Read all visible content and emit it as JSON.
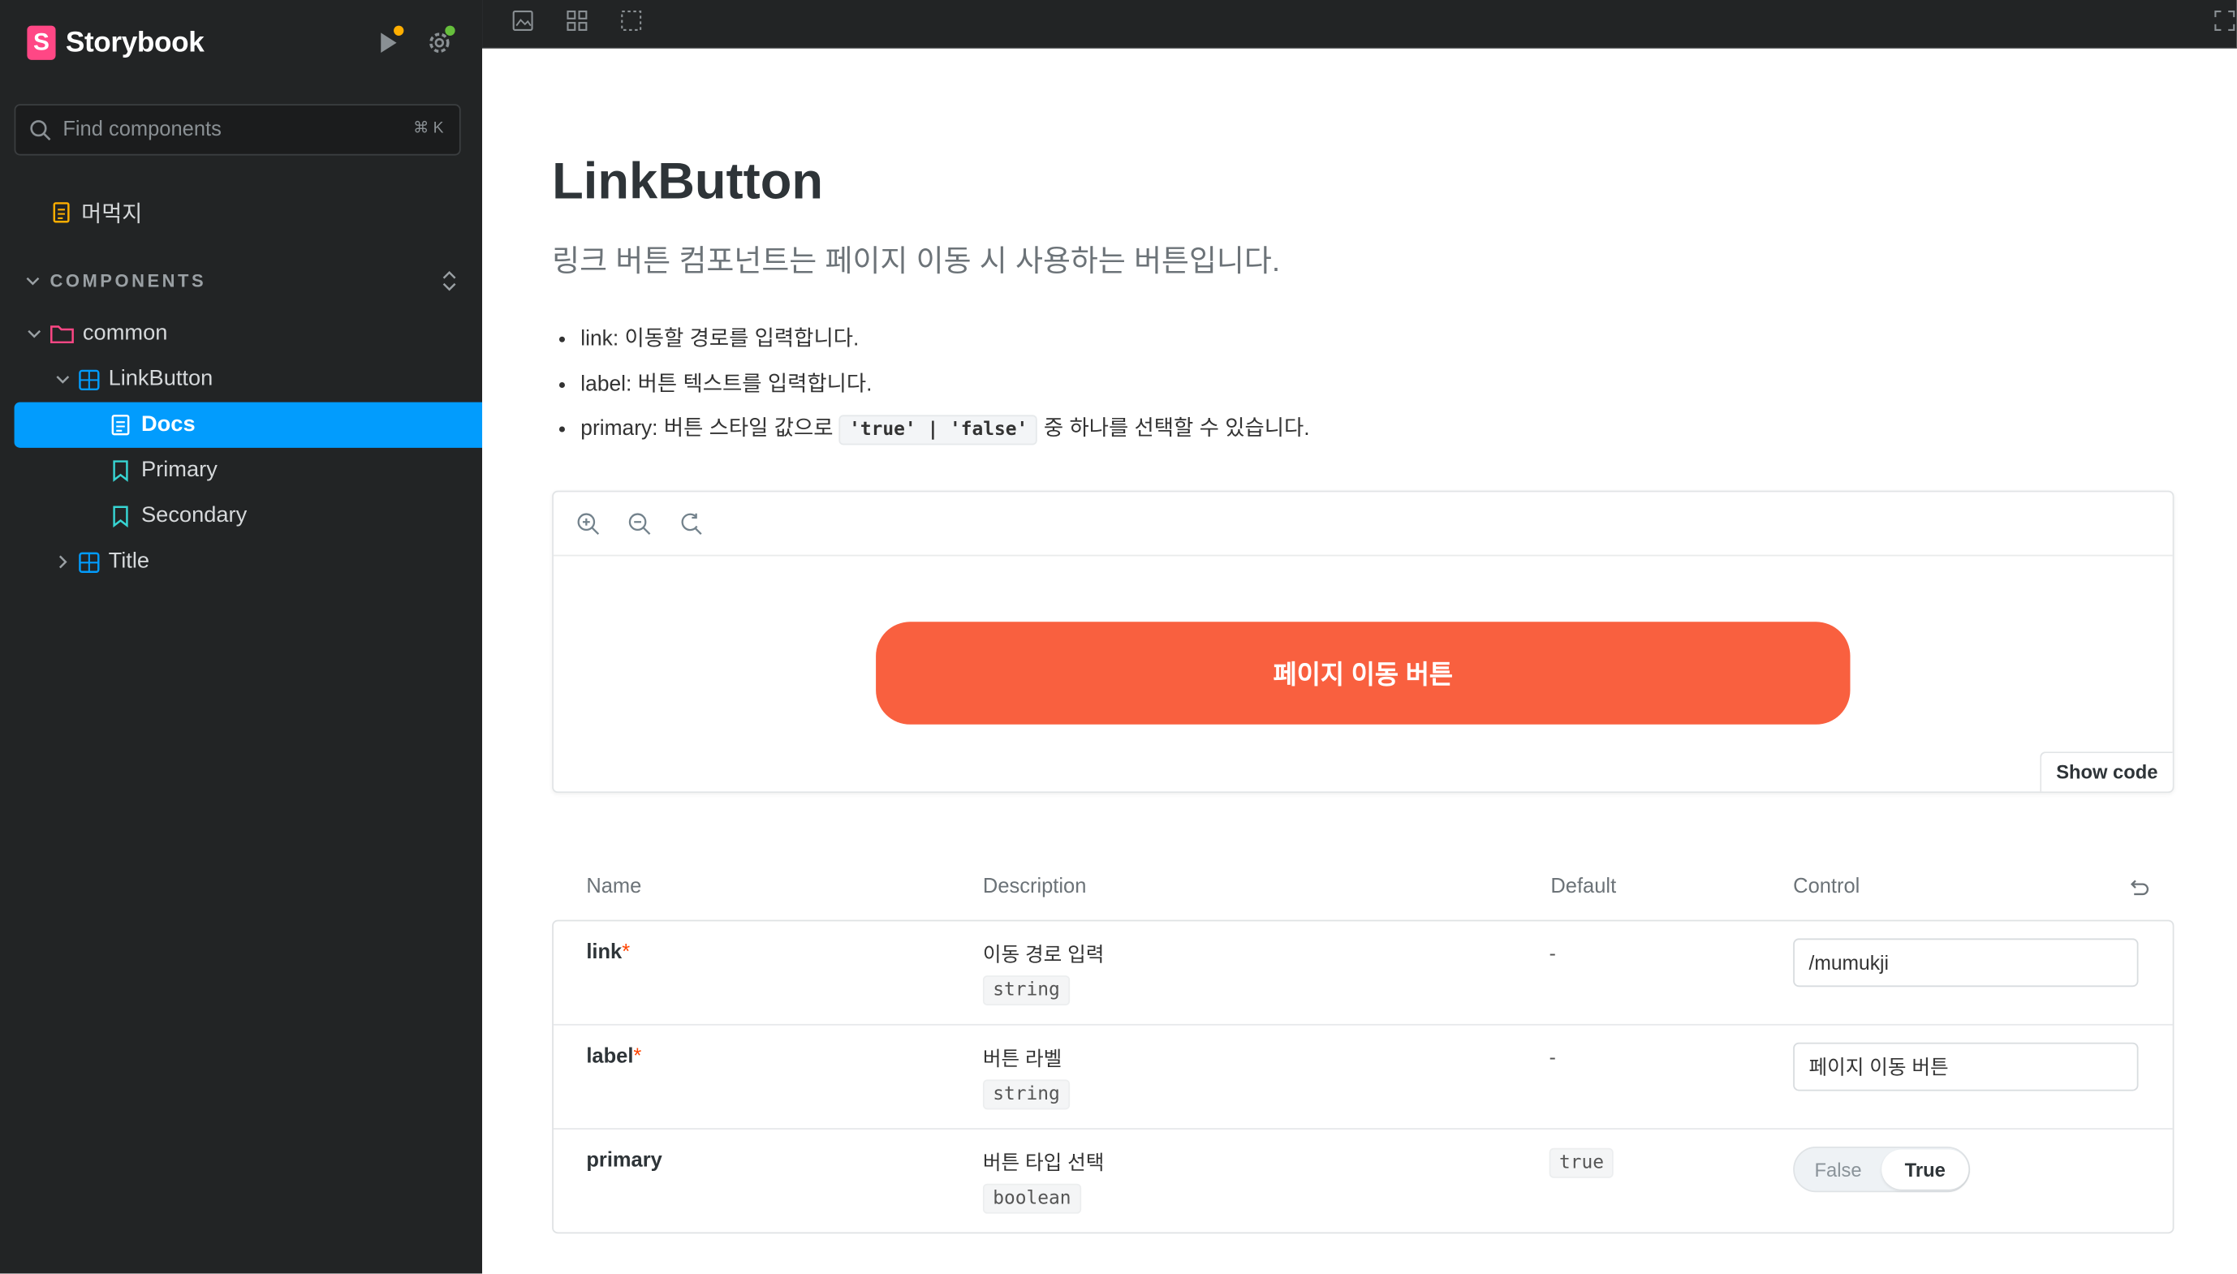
{
  "brand": {
    "name": "Storybook",
    "logo_letter": "S",
    "accent": "#ff4785",
    "link": "#029cfd"
  },
  "sidebar": {
    "search_placeholder": "Find components",
    "shortcut": "⌘ K",
    "intro_doc": "머먹지",
    "section_label": "COMPONENTS",
    "tree": {
      "group": "common",
      "component": "LinkButton",
      "stories": [
        "Docs",
        "Primary",
        "Secondary"
      ],
      "other_component": "Title"
    },
    "status_dots": {
      "warning": "#ffae00",
      "ok": "#66bf3c"
    }
  },
  "doc": {
    "title": "LinkButton",
    "subtitle": "링크 버튼 컴포넌트는 페이지 이동 시 사용하는 버튼입니다.",
    "bullets": {
      "b1": "link: 이동할 경로를 입력합니다.",
      "b2": "label: 버튼 텍스트를 입력합니다.",
      "b3_pre": "primary: 버튼 스타일 값으로",
      "b3_code": "'true' | 'false'",
      "b3_post": "중 하나를 선택할 수 있습니다."
    },
    "preview": {
      "button_label": "페이지 이동 버튼",
      "button_color": "#f9603f",
      "show_code": "Show code"
    },
    "args_table": {
      "headers": {
        "name": "Name",
        "description": "Description",
        "default": "Default",
        "control": "Control"
      },
      "rows": [
        {
          "name": "link",
          "required": "*",
          "description": "이동 경로 입력",
          "type": "string",
          "default": "-",
          "control_value": "/mumukji"
        },
        {
          "name": "label",
          "required": "*",
          "description": "버튼 라벨",
          "type": "string",
          "default": "-",
          "control_value": "페이지 이동 버튼"
        },
        {
          "name": "primary",
          "description": "버튼 타입 선택",
          "type": "boolean",
          "default": "true",
          "toggle": {
            "off": "False",
            "on": "True",
            "selected": "True"
          }
        }
      ]
    }
  }
}
